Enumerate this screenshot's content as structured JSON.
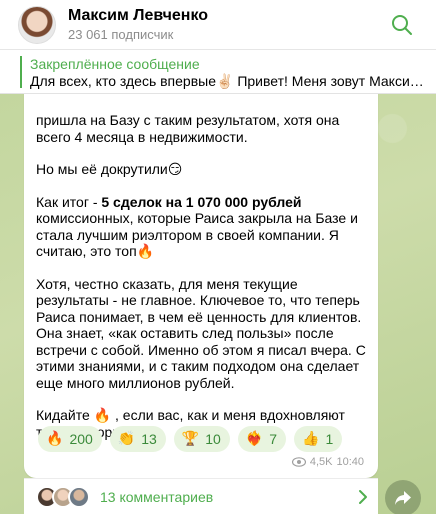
{
  "header": {
    "channel_name": "Максим Левченко",
    "subscribers": "23 061 подписчик"
  },
  "pinned": {
    "title": "Закреплённое сообщение",
    "text": "Для всех, кто здесь впервые✌🏻 Привет! Меня зовут Максим..."
  },
  "message": {
    "p1": "пришла на Базу с таким результатом, хотя она всего 4 месяца в недвижимости.",
    "p2": "Но мы её докрутили😏",
    "p3_prefix": "Как итог - ",
    "p3_bold": "5 сделок на 1 070 000 рублей",
    "p3_suffix": " комиссионных, которые Раиса закрыла на Базе и стала лучшим риэлтором в своей компании. Я считаю, это топ🔥",
    "p4": "Хотя, честно сказать, для меня текущие результаты - не главное. Ключевое то, что теперь Раиса понимает, в чем её ценность для клиентов. Она знает, «как оставить след пользы» после встречи с собой. Именно об этом я писал вчера. С этими знаниями, и с таким подходом она сделает еще много миллионов рублей.",
    "p5": "Кидайте 🔥 , если вас, как и меня вдохновляют такие истории)"
  },
  "reactions": [
    {
      "emoji": "🔥",
      "count": "200"
    },
    {
      "emoji": "👏",
      "count": "13"
    },
    {
      "emoji": "🏆",
      "count": "10"
    },
    {
      "emoji": "❤️‍🔥",
      "count": "7"
    },
    {
      "emoji": "👍",
      "count": "1"
    }
  ],
  "meta": {
    "views": "4,5K",
    "time": "10:40"
  },
  "comments": {
    "label": "13 комментариев"
  },
  "colors": {
    "accent": "#4fae4e",
    "background": "#c5d7a6"
  }
}
